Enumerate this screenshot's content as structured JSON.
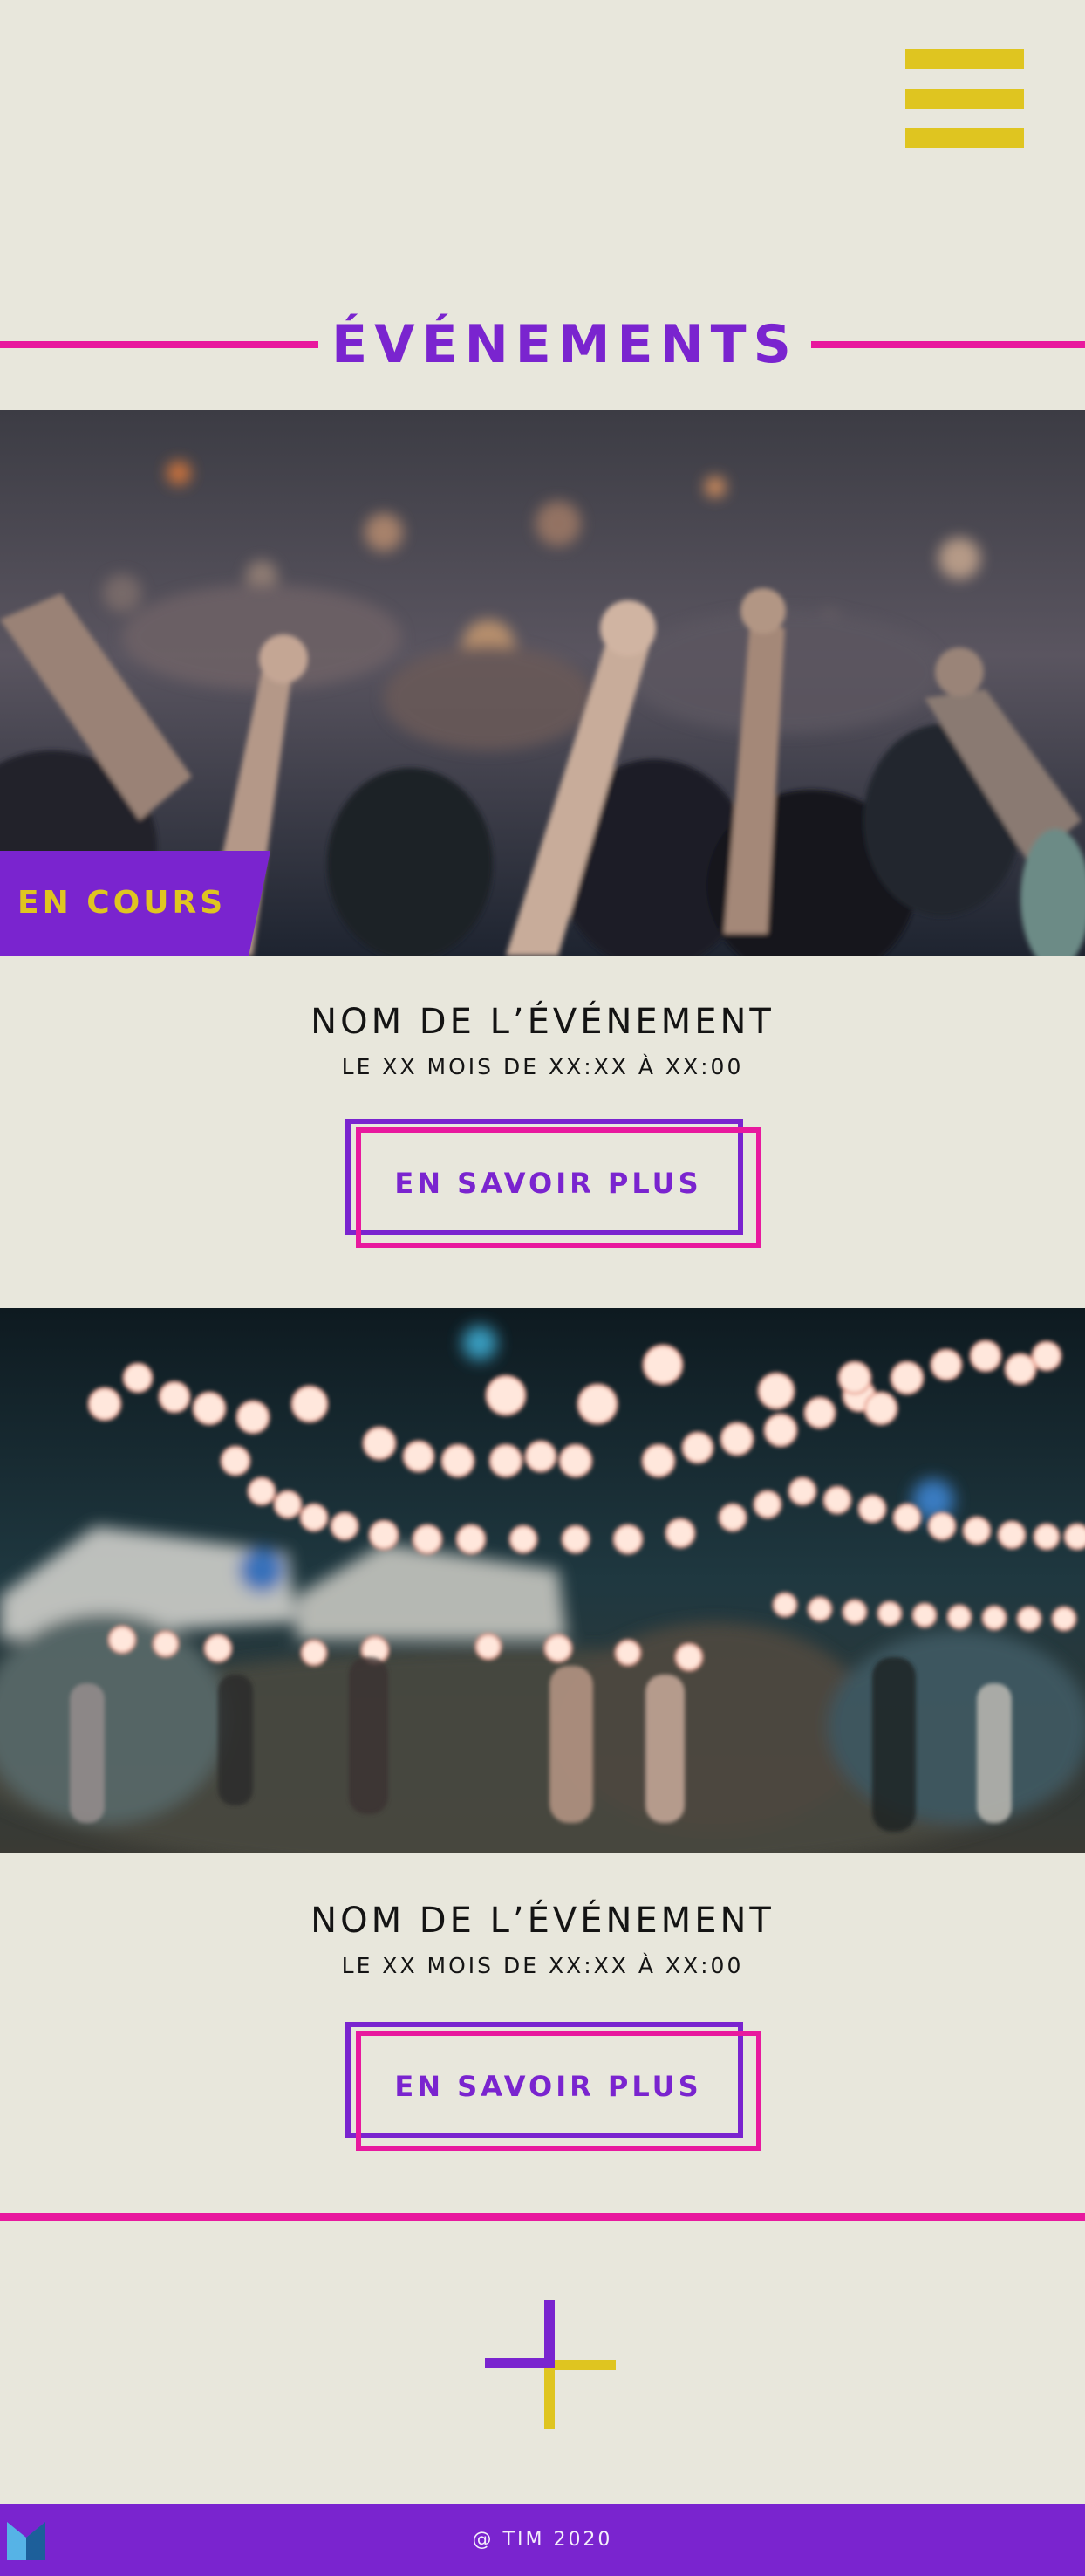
{
  "header": {
    "menu_icon": "hamburger-menu-icon"
  },
  "page": {
    "title": "ÉVÉNEMENTS"
  },
  "events": [
    {
      "badge": "EN COURS",
      "image": "concert crowd with raised hands",
      "name": "NOM DE L’ÉVÉNEMENT",
      "date": "LE XX MOIS DE XX:XX À XX:00",
      "button": "EN SAVOIR PLUS"
    },
    {
      "image": "night festival with string lights",
      "name": "NOM DE L’ÉVÉNEMENT",
      "date": "LE XX MOIS DE XX:XX À XX:00",
      "button": "EN SAVOIR PLUS"
    }
  ],
  "footer": {
    "copyright": "@ TIM 2020",
    "logo_icon": "brand-logo-icon"
  },
  "colors": {
    "background": "#e8e7dc",
    "purple": "#7a24cf",
    "magenta": "#e8199e",
    "yellow": "#dfc520"
  }
}
